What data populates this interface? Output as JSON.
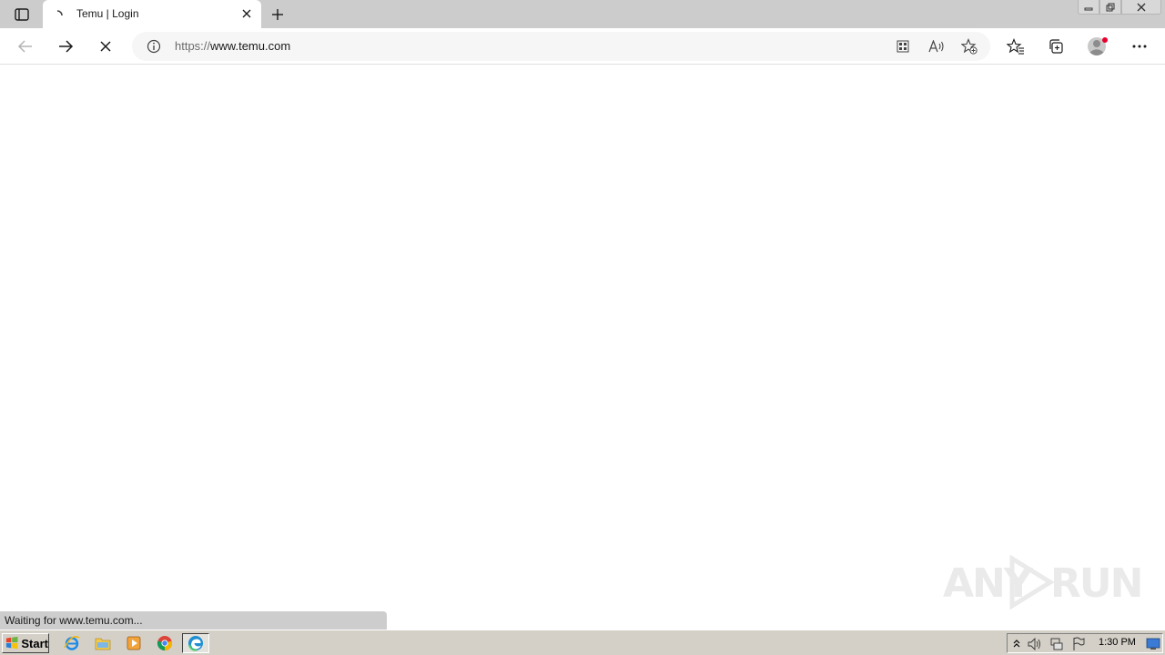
{
  "tab": {
    "title": "Temu | Login"
  },
  "address_bar": {
    "url_scheme": "https://",
    "url_host": "www.temu.com"
  },
  "status": {
    "text": "Waiting for www.temu.com..."
  },
  "watermark": {
    "left": "ANY",
    "right": "RUN"
  },
  "taskbar": {
    "start_label": "Start",
    "clock": "1:30 PM"
  },
  "icons": {
    "tab_actions": "tab-actions-icon",
    "favicon": "loading-icon",
    "close": "close-icon",
    "new_tab": "plus-icon",
    "back": "arrow-left-icon",
    "forward": "arrow-right-icon",
    "stop": "stop-icon",
    "info": "info-icon",
    "apps": "apps-icon",
    "read_aloud": "read-aloud-icon",
    "add_favorite": "star-plus-icon",
    "favorites": "favorites-icon",
    "collections": "collections-icon",
    "profile": "profile-icon",
    "more": "more-icon"
  },
  "colors": {
    "tab_bar": "#cccccc",
    "address_bar": "#f6f6f6",
    "status_bubble": "#cdcdcd",
    "taskbar": "#d4d0c8",
    "profile_dot": "#e8002d"
  }
}
